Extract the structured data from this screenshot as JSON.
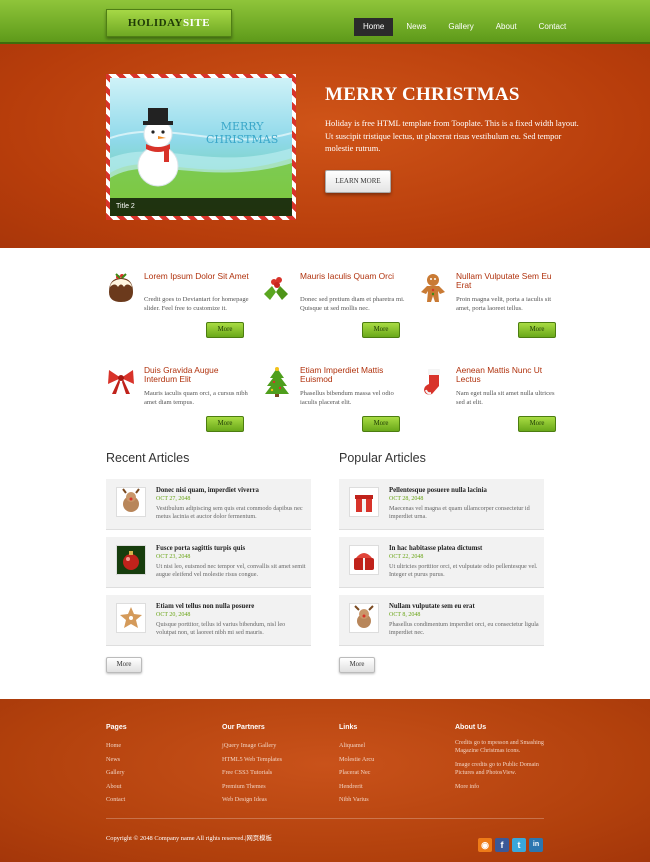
{
  "header": {
    "logo_main": "HOLIDAY",
    "logo_accent": "SITE",
    "nav": [
      "Home",
      "News",
      "Gallery",
      "About",
      "Contact"
    ],
    "active_nav": "Home"
  },
  "hero": {
    "slide_caption": "Title 2",
    "slide_text_line1": "MERRY",
    "slide_text_line2": "CHRISTMAS",
    "title": "MERRY CHRISTMAS",
    "text": "Holiday is free HTML template from Tooplate. This is a fixed width layout. Ut suscipit tristique lectus, ut placerat risus vestibulum eu. Sed tempor molestie rutrum.",
    "button": "LEARN MORE"
  },
  "features": [
    {
      "icon": "pudding-icon",
      "title": "Lorem Ipsum Dolor Sit Amet",
      "text": "Credit goes to Deviantart for homepage slider. Feel free to customize it.",
      "button": "More"
    },
    {
      "icon": "holly-icon",
      "title": "Mauris Iaculis Quam Orci",
      "text": "Donec sed pretium diam et pharetra mi. Quisque ut sed mollis nec.",
      "button": "More"
    },
    {
      "icon": "gingerbread-icon",
      "title": "Nullam Vulputate Sem Eu Erat",
      "text": "Proin magna velit, porta a iaculis sit amet, porta laoreet tellus.",
      "button": "More"
    },
    {
      "icon": "bow-icon",
      "title": "Duis Gravida Augue Interdum Elit",
      "text": "Mauris iaculis quam orci, a cursus nibh amet diam tempus.",
      "button": "More"
    },
    {
      "icon": "tree-icon",
      "title": "Etiam Imperdiet Mattis Euismod",
      "text": "Phasellus bibendum massa vel odio iaculis placerat elit.",
      "button": "More"
    },
    {
      "icon": "stocking-icon",
      "title": "Aenean Mattis Nunc Ut Lectus",
      "text": "Nam eget nulla sit amet nulla ultrices sed at elit.",
      "button": "More"
    }
  ],
  "recent": {
    "title": "Recent Articles",
    "button": "More",
    "items": [
      {
        "thumb": "reindeer-thumb",
        "title": "Donec nisi quam, imperdiet viverra",
        "date": "OCT 27, 2048",
        "text": "Vestibulum adipiscing sem quis erat commodo dapibus nec metus lacinia et auctor dolor fermentum."
      },
      {
        "thumb": "ornament-thumb",
        "title": "Fusce porta sagittis turpis quis",
        "date": "OCT 23, 2048",
        "text": "Ut nisi leo, euismod nec tempor vel, convallis sit amet semit augue eleifend vel molestie risus congue."
      },
      {
        "thumb": "cookie-thumb",
        "title": "Etiam vel tellus non nulla posuere",
        "date": "OCT 20, 2048",
        "text": "Quisque porttitor, tellus id varius bibendum, nisl leo volutpat non, ut laoreet nibh mi sed mauris."
      }
    ]
  },
  "popular": {
    "title": "Popular Articles",
    "button": "More",
    "items": [
      {
        "thumb": "gift-thumb",
        "title": "Pellentesque posuere nulla lacinia",
        "date": "OCT 28, 2048",
        "text": "Maecenas vel magna et quam ullamcorper consectetur id imperdiet urna."
      },
      {
        "thumb": "present-thumb",
        "title": "In hac habitasse platea dictumst",
        "date": "OCT 22, 2048",
        "text": "Ut ultricies porttitor orci, et vulputate odio pellentesque vel. Integer et purus purus."
      },
      {
        "thumb": "reindeer2-thumb",
        "title": "Nullam vulputate sem eu erat",
        "date": "OCT 8, 2048",
        "text": "Phasellus condimentum imperdiet orci, eu consectetur ligula imperdiet nec."
      }
    ]
  },
  "footer": {
    "pages_title": "Pages",
    "pages": [
      "Home",
      "News",
      "Gallery",
      "About",
      "Contact"
    ],
    "partners_title": "Our Partners",
    "partners": [
      "jQuery Image Gallery",
      "HTML5 Web Templates",
      "Free CSS3 Tutorials",
      "Premium Themes",
      "Web Design Ideas"
    ],
    "links_title": "Links",
    "links": [
      "Aliquamel",
      "Molestie Arcu",
      "Placerat Nec",
      "Hendrerit",
      "Nibh Varius"
    ],
    "about_title": "About Us",
    "about_p1": "Credits go to mpesson and Smashing Magazine Christmas icons.",
    "about_p2": "Image credits go to Public Domain Pictures and PhotosView.",
    "about_more": "More info",
    "copyright": "Copyright © 2048 Company name All rights reserved.|网页模板"
  },
  "social": [
    {
      "icon": "rss-icon",
      "color": "#ee7b18",
      "glyph": "◉"
    },
    {
      "icon": "facebook-icon",
      "color": "#3b5998",
      "glyph": "f"
    },
    {
      "icon": "twitter-icon",
      "color": "#3aa7d9",
      "glyph": "t"
    },
    {
      "icon": "linkedin-icon",
      "color": "#2b76b0",
      "glyph": "in"
    }
  ]
}
